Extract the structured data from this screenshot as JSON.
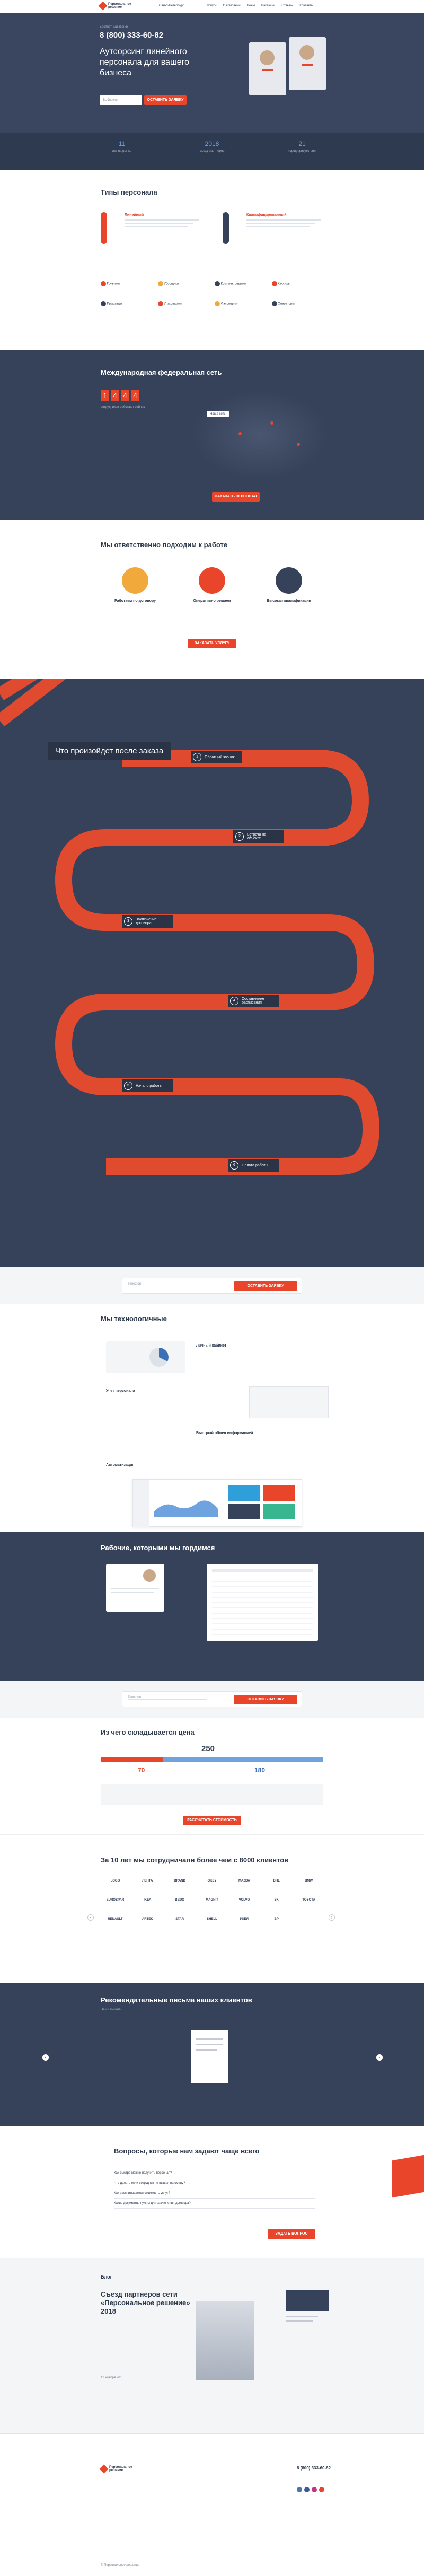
{
  "header": {
    "logo_text": "Персональное решение",
    "city": "Санкт-Петербург",
    "nav": [
      "Услуги",
      "О компании",
      "Цены",
      "Вакансии",
      "Отзывы",
      "Контакты"
    ],
    "phone_label": "Бесплатный звонок",
    "phone": "8 (800) 333-60-82",
    "headline": "Аутсорсинг линейного персонала для вашего бизнеса",
    "select_placeholder": "Выберите",
    "cta": "ОСТАВИТЬ ЗАЯВКУ"
  },
  "stats": [
    {
      "value": "11",
      "label": "лет на рынке"
    },
    {
      "value": "2018",
      "label": "съезд партнеров"
    },
    {
      "value": "21",
      "label": "город присутствия"
    }
  ],
  "types": {
    "title": "Типы персонала",
    "left_title": "Линейный",
    "right_title": "Квалифицированный",
    "items": [
      "Грузчики",
      "Уборщики",
      "Комплектовщики",
      "Кассиры",
      "Продавцы",
      "Упаковщики",
      "Фасовщики",
      "Операторы"
    ]
  },
  "network": {
    "title": "Международная федеральная сеть",
    "counter": [
      "1",
      "4",
      "4",
      "4"
    ],
    "counter_label": "сотрудников работают сейчас",
    "map_label": "Наша сеть",
    "cta": "ЗАКАЗАТЬ ПЕРСОНАЛ"
  },
  "approach": {
    "title": "Мы ответственно подходим к работе",
    "items": [
      {
        "title": "Работаем по договору"
      },
      {
        "title": "Оперативно решаем"
      },
      {
        "title": "Высокая квалификация"
      }
    ],
    "cta": "ЗАКАЗАТЬ УСЛУГУ"
  },
  "process": {
    "title": "Что произойдет после заказа",
    "steps": [
      {
        "num": "1",
        "label": "Обратный звонок"
      },
      {
        "num": "2",
        "label": "Встреча на объекте"
      },
      {
        "num": "3",
        "label": "Заключение договора"
      },
      {
        "num": "4",
        "label": "Составление расписания"
      },
      {
        "num": "5",
        "label": "Начало работы"
      },
      {
        "num": "6",
        "label": "Оплата работы"
      }
    ]
  },
  "form_bar": {
    "placeholder": "Телефон",
    "cta": "ОСТАВИТЬ ЗАЯВКУ"
  },
  "tech": {
    "title": "Мы технологичные",
    "items": [
      "Личный кабинет",
      "Учет персонала",
      "Быстрый обмен информацией",
      "Автоматизация"
    ]
  },
  "workers": {
    "title": "Рабочие, которыми мы гордимся"
  },
  "price": {
    "title": "Из чего складывается цена",
    "total": "250",
    "left_value": "70",
    "right_value": "180",
    "cta": "РАССЧИТАТЬ СТОИМОСТЬ"
  },
  "clients": {
    "title": "За 10 лет мы сотрудничали более чем с 8000 клиентов",
    "logos": [
      "LOGO",
      "ЛЕНТА",
      "BRAND",
      "OKEY",
      "MAZDA",
      "DHL",
      "BMW",
      "EUROSPAR",
      "IKEA",
      "BBDO",
      "MAGNIT",
      "VOLVO",
      "SK",
      "TOYOTA",
      "RENAULT",
      "ARTEK",
      "STAR",
      "SHELL",
      "ИКЕЯ",
      "BP"
    ]
  },
  "letters": {
    "title": "Рекомендательные письма наших клиентов",
    "subtitle": "Наши письма"
  },
  "faq": {
    "title": "Вопросы, которые нам задают чаще всего",
    "questions": [
      "Как быстро можно получить персонал?",
      "Что делать если сотрудник не вышел на смену?",
      "Как рассчитывается стоимость услуг?",
      "Какие документы нужны для заключения договора?"
    ],
    "cta": "ЗАДАТЬ ВОПРОС"
  },
  "blog": {
    "label": "Блог",
    "title": "Съезд партнеров сети «Персональное решение» 2018",
    "date": "12 ноября 2018"
  },
  "footer": {
    "logo_text": "Персональное решение",
    "phone": "8 (800) 333-60-82",
    "copyright": "© Персональное решение"
  },
  "colors": {
    "dark": "#36415a",
    "accent": "#e8452b",
    "road": "#e04a2f"
  }
}
